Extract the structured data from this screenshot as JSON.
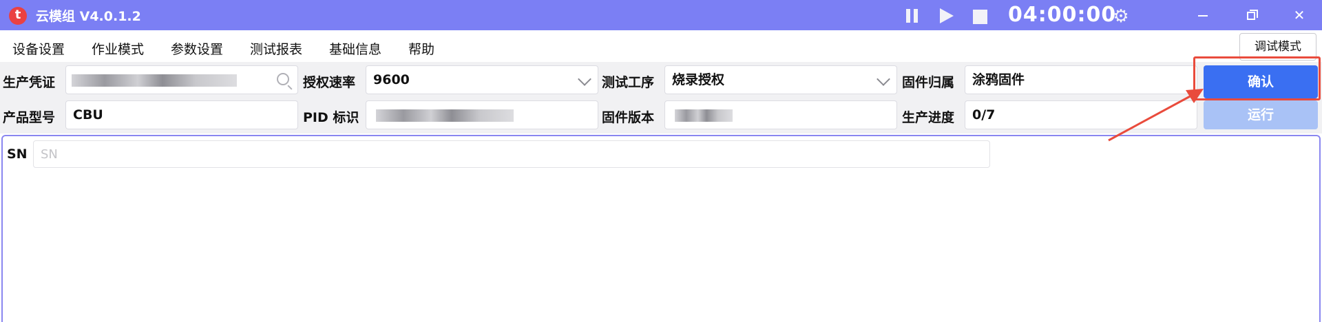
{
  "window": {
    "title": "云模组 V4.0.1.2",
    "logo_glyph": "t",
    "timer": "04:00:00",
    "icons": [
      "pause-icon",
      "play-icon",
      "stop-icon",
      "gear-icon",
      "minimize-icon",
      "maximize-icon",
      "close-icon"
    ],
    "colors": {
      "titlebar": "#7b7ff4",
      "accent": "#3a6ff2",
      "logo": "#ea4142",
      "highlight": "#e94b3c"
    }
  },
  "menu": {
    "items": [
      "设备设置",
      "作业模式",
      "参数设置",
      "测试报表",
      "基础信息",
      "帮助"
    ],
    "debug_mode_label": "调试模式"
  },
  "form": {
    "production_credential": {
      "label": "生产凭证",
      "value": ""
    },
    "auth_rate": {
      "label": "授权速率",
      "value": "9600"
    },
    "test_process": {
      "label": "测试工序",
      "value": "烧录授权"
    },
    "firmware_owner": {
      "label": "固件归属",
      "value": "涂鸦固件"
    },
    "product_model": {
      "label": "产品型号",
      "value": "CBU"
    },
    "pid": {
      "label": "PID 标识",
      "value": ""
    },
    "firmware_version": {
      "label": "固件版本",
      "value": ""
    },
    "production_progress": {
      "label": "生产进度",
      "value": "0/7"
    }
  },
  "actions": {
    "confirm_label": "确认",
    "run_label": "运行"
  },
  "sn": {
    "label": "SN",
    "placeholder": "SN",
    "value": ""
  }
}
